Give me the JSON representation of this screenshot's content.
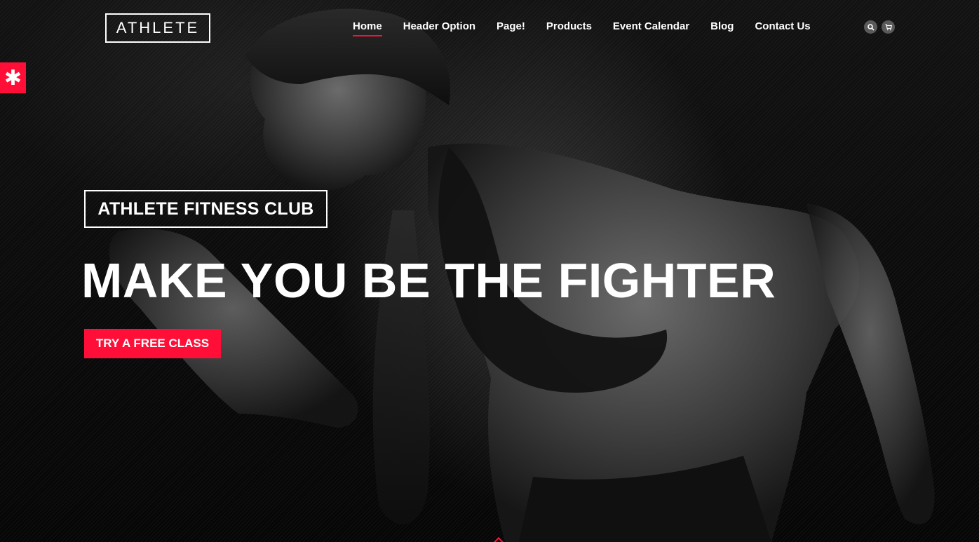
{
  "brand": {
    "logo_text": "ATHLETE"
  },
  "nav": {
    "items": [
      {
        "label": "Home",
        "active": true
      },
      {
        "label": "Header Option",
        "active": false
      },
      {
        "label": "Page!",
        "active": false
      },
      {
        "label": "Products",
        "active": false
      },
      {
        "label": "Event Calendar",
        "active": false
      },
      {
        "label": "Blog",
        "active": false
      },
      {
        "label": "Contact Us",
        "active": false
      }
    ]
  },
  "header_icons": {
    "search": "search-icon",
    "cart": "cart-icon"
  },
  "side_tab": {
    "symbol": "✱"
  },
  "hero": {
    "subtitle": "ATHLETE FITNESS CLUB",
    "headline": "MAKE YOU BE THE FIGHTER",
    "cta_label": "TRY A FREE CLASS"
  },
  "colors": {
    "accent": "#ff0f37",
    "text": "#ffffff",
    "background": "#0b0b0b"
  }
}
